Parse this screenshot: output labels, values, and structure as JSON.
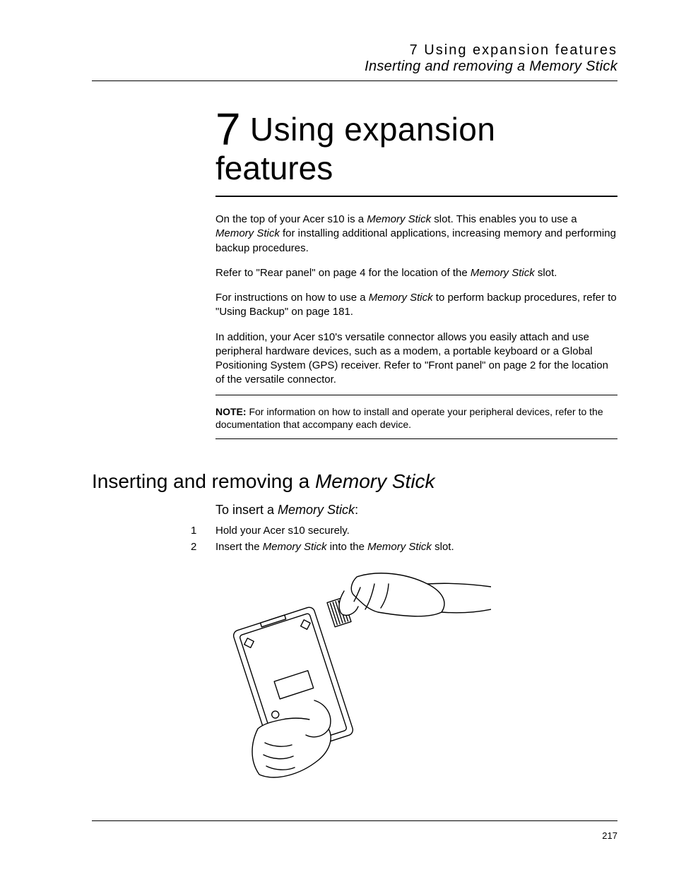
{
  "header": {
    "line1": "7 Using expansion features",
    "line2": "Inserting and removing a Memory Stick"
  },
  "chapter": {
    "number": "7",
    "title_part1": " Using expansion",
    "title_line2": "features"
  },
  "paragraphs": {
    "p1_a": "On the top of your Acer s10 is a ",
    "p1_em1": "Memory Stick",
    "p1_b": " slot. This enables you to use a ",
    "p1_em2": "Memory Stick",
    "p1_c": " for installing additional applications, increasing memory and performing backup procedures.",
    "p2_a": "Refer to \"Rear panel\" on page 4 for the location of the ",
    "p2_em1": "Memory Stick",
    "p2_b": " slot.",
    "p3_a": "For instructions on how to use a ",
    "p3_em1": "Memory Stick",
    "p3_b": " to perform backup procedures, refer to \"Using Backup\" on page 181.",
    "p4": "In addition, your Acer s10's versatile connector allows you easily attach and use peripheral hardware devices, such as a modem, a portable keyboard or a Global Positioning System (GPS) receiver. Refer to \"Front panel\" on page 2 for the location of the versatile connector."
  },
  "note": {
    "label": "NOTE:",
    "text": "   For information on how to install and operate your peripheral devices, refer to the documentation that accompany each device."
  },
  "section": {
    "heading_a": "Inserting and removing a ",
    "heading_em": "Memory Stick",
    "sub_a": "To insert a ",
    "sub_em": "Memory Stick",
    "sub_b": ":"
  },
  "steps": {
    "s1_num": "1",
    "s1_text": "Hold your Acer s10 securely.",
    "s2_num": "2",
    "s2_a": "Insert the ",
    "s2_em1": "Memory Stick",
    "s2_b": " into the ",
    "s2_em2": "Memory Stick",
    "s2_c": " slot."
  },
  "page_number": "217"
}
